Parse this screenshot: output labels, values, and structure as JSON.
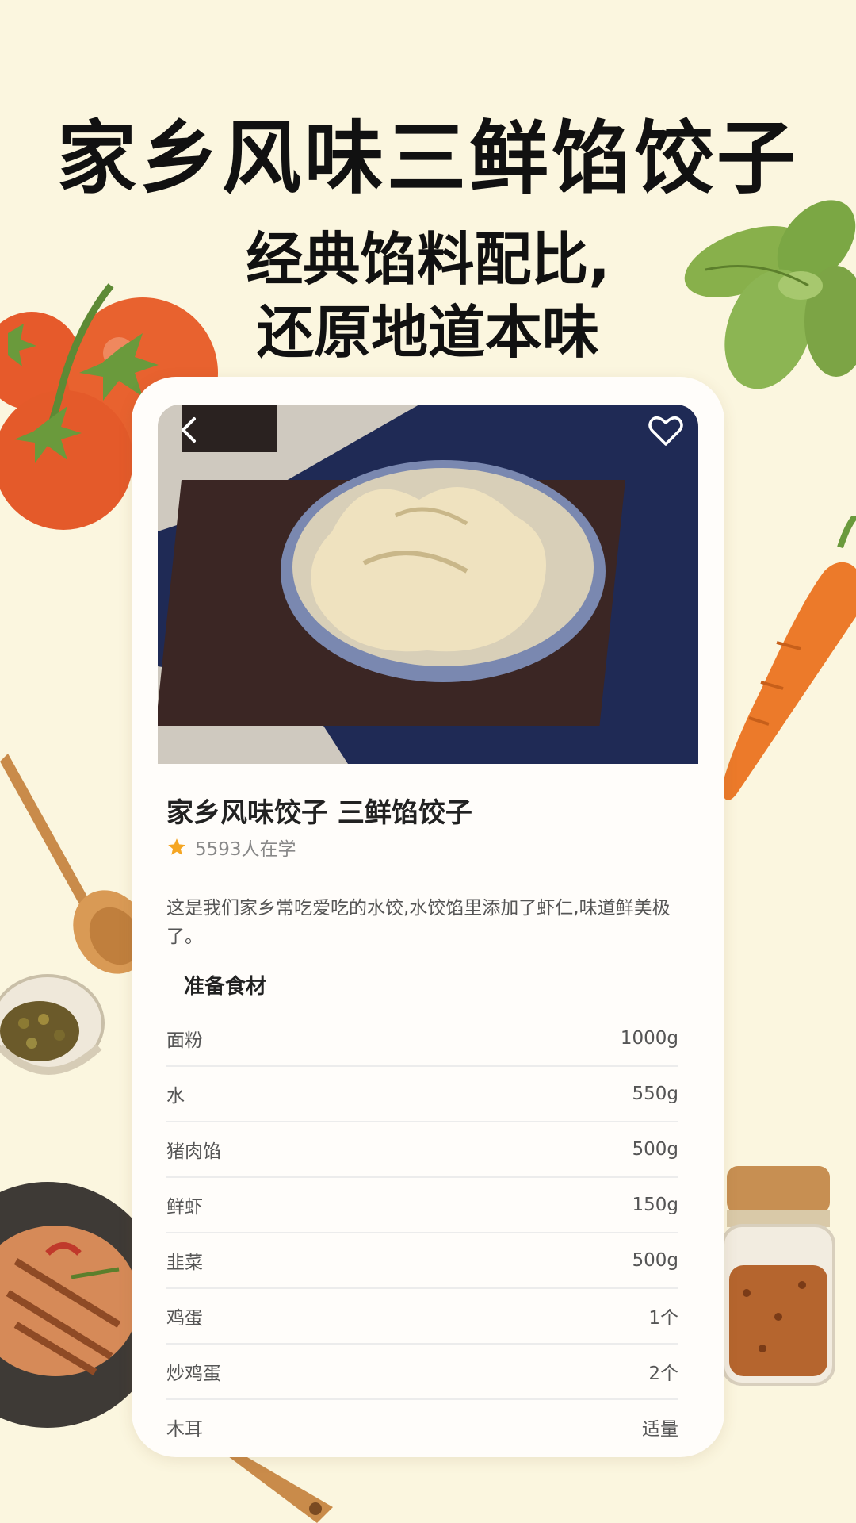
{
  "promo": {
    "headline": "家乡风味三鲜馅饺子",
    "subline_1": "经典馅料配比,",
    "subline_2": "还原地道本味"
  },
  "recipe": {
    "title": "家乡风味饺子 三鲜馅饺子",
    "learners": "5593人在学",
    "description": "这是我们家乡常吃爱吃的水饺,水饺馅里添加了虾仁,味道鲜美极了。",
    "ingredients_title": "准备食材",
    "ingredients": [
      {
        "name": "面粉",
        "amount": "1000g"
      },
      {
        "name": "水",
        "amount": "550g"
      },
      {
        "name": "猪肉馅",
        "amount": "500g"
      },
      {
        "name": "鲜虾",
        "amount": "150g"
      },
      {
        "name": "韭菜",
        "amount": "500g"
      },
      {
        "name": "鸡蛋",
        "amount": "1个"
      },
      {
        "name": "炒鸡蛋",
        "amount": "2个"
      },
      {
        "name": "木耳",
        "amount": "适量"
      }
    ]
  },
  "icons": {
    "back": "chevron-left-icon",
    "favorite": "heart-outline-icon",
    "rating": "star-icon"
  },
  "colors": {
    "background": "#fbf6df",
    "star": "#f5a623"
  }
}
